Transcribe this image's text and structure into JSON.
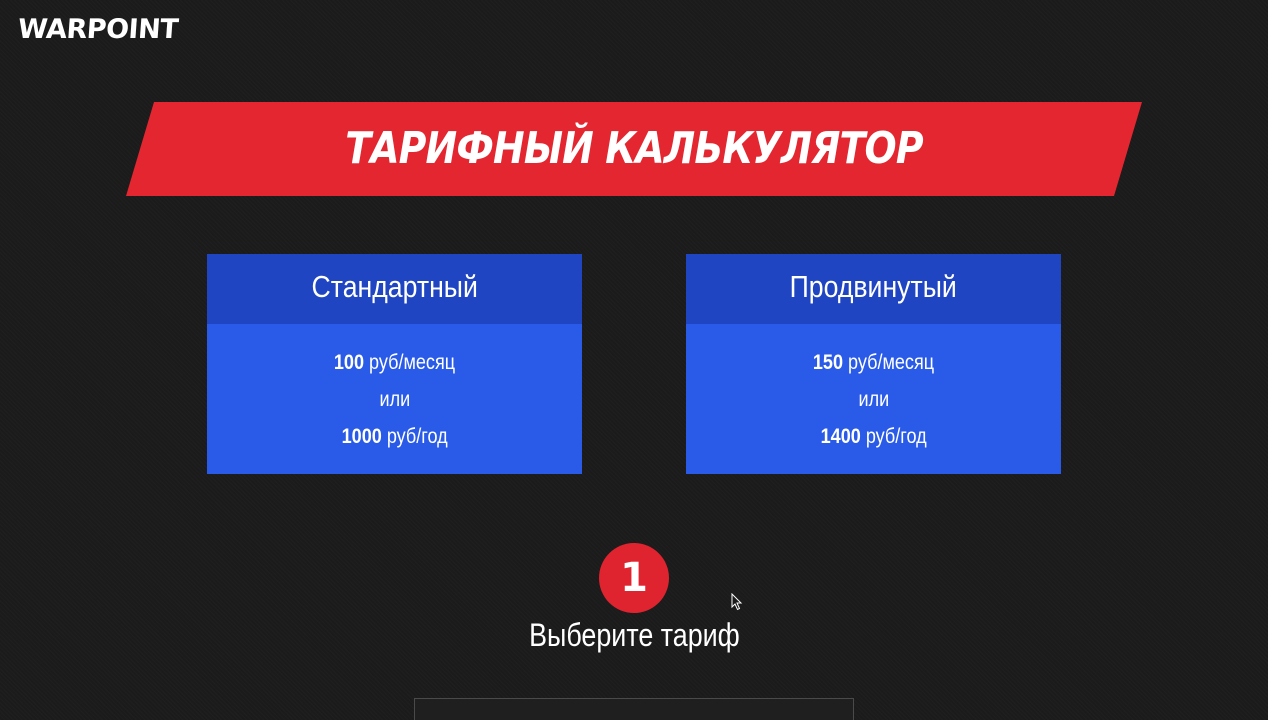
{
  "header": {
    "logo_text": "WARPOINT"
  },
  "banner": {
    "title": "ТАРИФНЫЙ КАЛЬКУЛЯТОР",
    "color": "#e3262f"
  },
  "plans": [
    {
      "name": "Стандартный",
      "month_price": "100",
      "month_unit": "руб/месяц",
      "separator": "или",
      "year_price": "1000",
      "year_unit": "руб/год"
    },
    {
      "name": "Продвинутый",
      "month_price": "150",
      "month_unit": "руб/месяц",
      "separator": "или",
      "year_price": "1400",
      "year_unit": "руб/год"
    }
  ],
  "step": {
    "number": "1",
    "label": "Выберите тариф"
  },
  "colors": {
    "background": "#1b1b1b",
    "plan_header": "#1f45c2",
    "plan_body": "#2a5be8",
    "accent_red": "#e0242f"
  }
}
